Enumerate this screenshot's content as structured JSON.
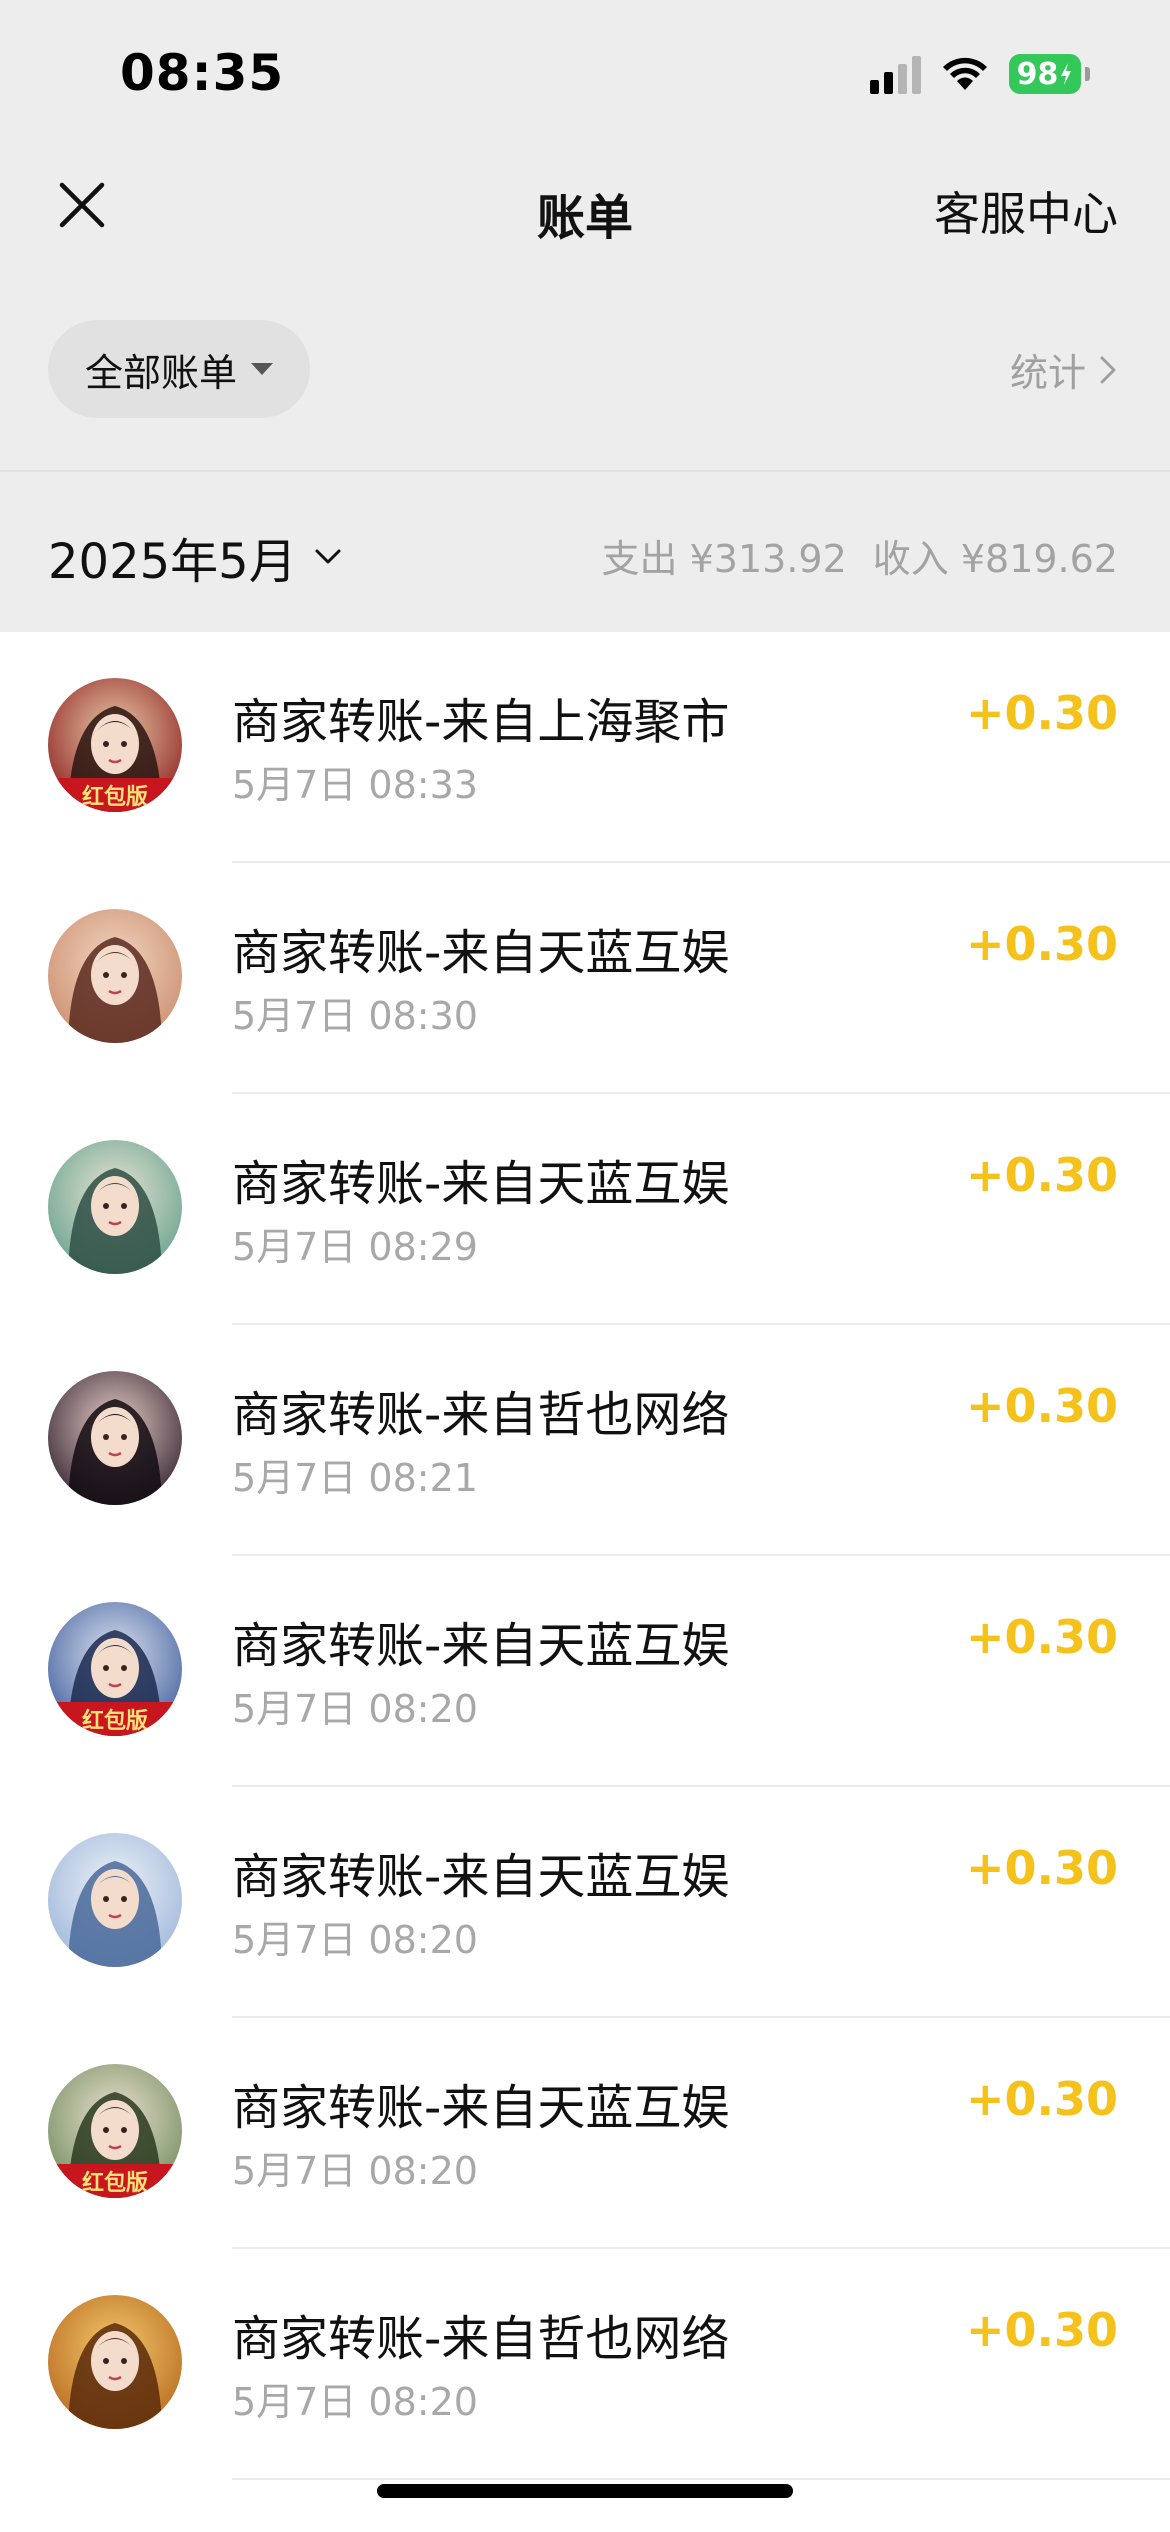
{
  "status_bar": {
    "time": "08:35",
    "battery": "98",
    "signal_icon": "cellular-signal-icon",
    "wifi_icon": "wifi-icon",
    "battery_icon": "battery-charging-icon"
  },
  "nav": {
    "title": "账单",
    "right_link": "客服中心",
    "close_icon": "close-icon"
  },
  "filter": {
    "label": "全部账单",
    "stats_label": "统计"
  },
  "month": {
    "label": "2025年5月",
    "expense": "支出 ¥313.92",
    "income": "收入 ¥819.62"
  },
  "colors": {
    "amount": "#f5c21b",
    "background_grey": "#ededed",
    "battery_green": "#34c759"
  },
  "transactions": [
    {
      "title": "商家转账-来自上海聚市",
      "time": "5月7日 08:33",
      "amount": "+0.30",
      "avatar_badge": "红包版"
    },
    {
      "title": "商家转账-来自天蓝互娱",
      "time": "5月7日 08:30",
      "amount": "+0.30",
      "avatar_badge": ""
    },
    {
      "title": "商家转账-来自天蓝互娱",
      "time": "5月7日 08:29",
      "amount": "+0.30",
      "avatar_badge": ""
    },
    {
      "title": "商家转账-来自哲也网络",
      "time": "5月7日 08:21",
      "amount": "+0.30",
      "avatar_badge": ""
    },
    {
      "title": "商家转账-来自天蓝互娱",
      "time": "5月7日 08:20",
      "amount": "+0.30",
      "avatar_badge": "红包版"
    },
    {
      "title": "商家转账-来自天蓝互娱",
      "time": "5月7日 08:20",
      "amount": "+0.30",
      "avatar_badge": ""
    },
    {
      "title": "商家转账-来自天蓝互娱",
      "time": "5月7日 08:20",
      "amount": "+0.30",
      "avatar_badge": "红包版"
    },
    {
      "title": "商家转账-来自哲也网络",
      "time": "5月7日 08:20",
      "amount": "+0.30",
      "avatar_badge": ""
    }
  ]
}
